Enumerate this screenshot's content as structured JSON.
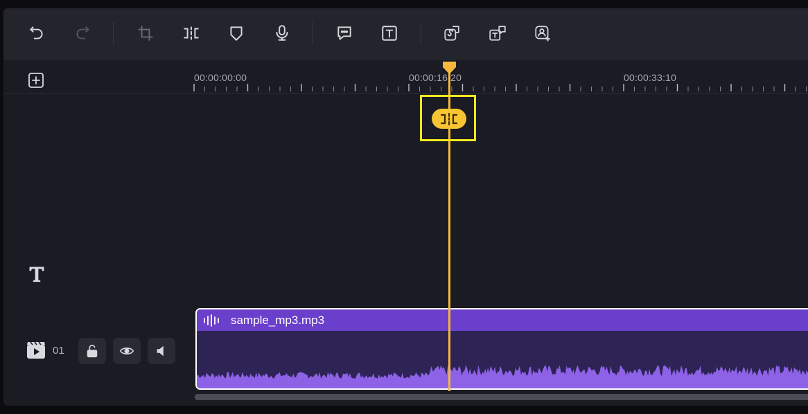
{
  "toolbar": {
    "buttons": [
      {
        "name": "undo-icon",
        "enabled": true
      },
      {
        "name": "redo-icon",
        "enabled": false
      },
      {
        "name": "crop-icon",
        "enabled": false
      },
      {
        "name": "split-icon",
        "enabled": true
      },
      {
        "name": "marker-icon",
        "enabled": true
      },
      {
        "name": "microphone-icon",
        "enabled": true
      },
      {
        "name": "speech-bubble-icon",
        "enabled": true
      },
      {
        "name": "text-icon",
        "enabled": true
      },
      {
        "name": "speech-to-text-icon",
        "enabled": true
      },
      {
        "name": "text-to-speech-icon",
        "enabled": true
      },
      {
        "name": "ai-portrait-icon",
        "enabled": true
      }
    ]
  },
  "ruler": {
    "timecodes": [
      "00:00:00:00",
      "00:00:16:20",
      "00:00:33:10"
    ]
  },
  "playhead": {
    "timecode_position": "00:00:16:20"
  },
  "tracks": {
    "text_track_icon": "text-track-icon",
    "audio_track": {
      "number": "01",
      "lock_icon": "unlock-icon",
      "visibility_icon": "eye-icon",
      "volume_icon": "speaker-icon"
    }
  },
  "clip": {
    "name": "sample_mp3.mp3",
    "icon": "audio-wave-icon"
  },
  "colors": {
    "accent": "#f6b73c",
    "highlight": "#f4ea1f",
    "clip_header": "#6a3fcb",
    "clip_body": "#2d2455",
    "waveform": "#8e62e6",
    "panel": "#1b1b24",
    "toolbar": "#24242d"
  }
}
